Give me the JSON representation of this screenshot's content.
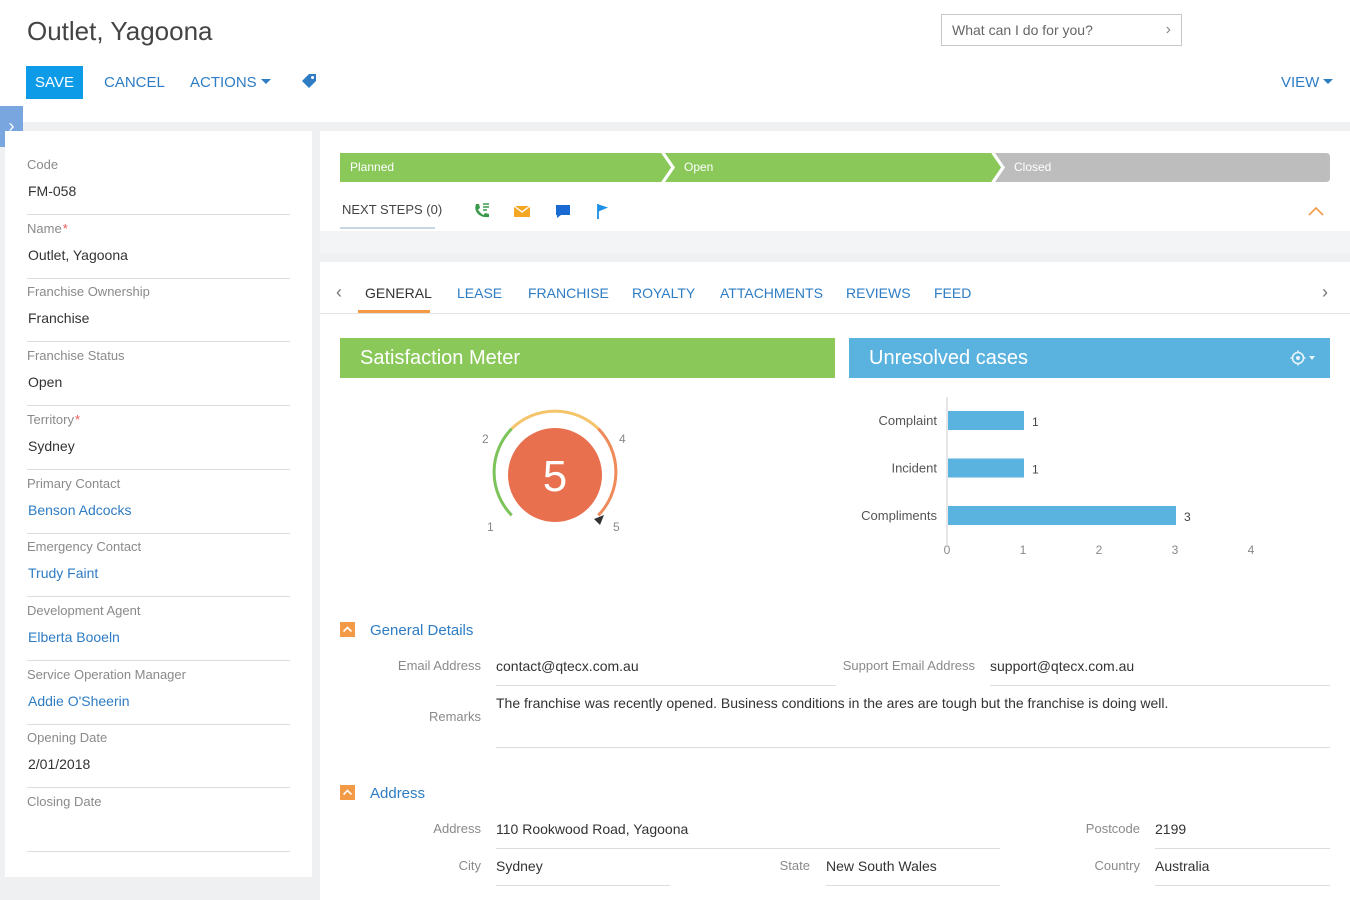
{
  "header": {
    "title": "Outlet, Yagoona",
    "command_placeholder": "What can I do for you?",
    "save_label": "SAVE",
    "cancel_label": "CANCEL",
    "actions_label": "ACTIONS",
    "view_label": "VIEW"
  },
  "left_fields": [
    {
      "label": "Code",
      "value": "FM-058"
    },
    {
      "label": "Name",
      "required": "*",
      "value": "Outlet, Yagoona"
    },
    {
      "label": "Franchise Ownership",
      "value": "Franchise"
    },
    {
      "label": "Franchise Status",
      "value": "Open"
    },
    {
      "label": "Territory",
      "required": "*",
      "value": "Sydney"
    },
    {
      "label": "Primary Contact",
      "value": "Benson Adcocks"
    },
    {
      "label": "Emergency Contact",
      "value": "Trudy Faint"
    },
    {
      "label": "Development Agent",
      "value": "Elberta Booeln"
    },
    {
      "label": "Service Operation Manager",
      "value": "Addie O'Sheerin"
    },
    {
      "label": "Opening Date",
      "value": "2/01/2018"
    },
    {
      "label": "Closing Date",
      "value": ""
    }
  ],
  "stages": [
    {
      "label": "Planned",
      "color": "#8ac85a"
    },
    {
      "label": "Open",
      "color": "#8ac85a"
    },
    {
      "label": "Closed",
      "color": "#bdbdbd"
    }
  ],
  "next_steps_label": "NEXT STEPS (0)",
  "tabs": [
    "GENERAL",
    "LEASE",
    "FRANCHISE",
    "ROYALTY",
    "ATTACHMENTS",
    "REVIEWS",
    "FEED"
  ],
  "satisfaction": {
    "title": "Satisfaction Meter",
    "value": "5",
    "tick_labels": [
      "1",
      "2",
      "4",
      "5"
    ]
  },
  "unresolved": {
    "title": "Unresolved cases"
  },
  "chart_data": {
    "type": "bar",
    "orientation": "horizontal",
    "title": "Unresolved cases",
    "categories": [
      "Complaint",
      "Incident",
      "Compliments"
    ],
    "values": [
      1,
      1,
      3
    ],
    "xlim": [
      0,
      4
    ],
    "x_ticks": [
      "0",
      "1",
      "2",
      "3",
      "4"
    ],
    "color": "#5ab2df",
    "grid": false
  },
  "general_details": {
    "title": "General Details",
    "email_label": "Email Address",
    "email_value": "contact@qtecx.com.au",
    "support_email_label": "Support Email Address",
    "support_email_value": "support@qtecx.com.au",
    "remarks_label": "Remarks",
    "remarks_value": "The franchise was recently opened. Business conditions in the ares are tough but the franchise is doing well."
  },
  "address": {
    "title": "Address",
    "address_label": "Address",
    "address_value": "110 Rookwood Road, Yagoona",
    "postcode_label": "Postcode",
    "postcode_value": "2199",
    "city_label": "City",
    "city_value": "Sydney",
    "state_label": "State",
    "state_value": "New South Wales",
    "country_label": "Country",
    "country_value": "Australia"
  }
}
